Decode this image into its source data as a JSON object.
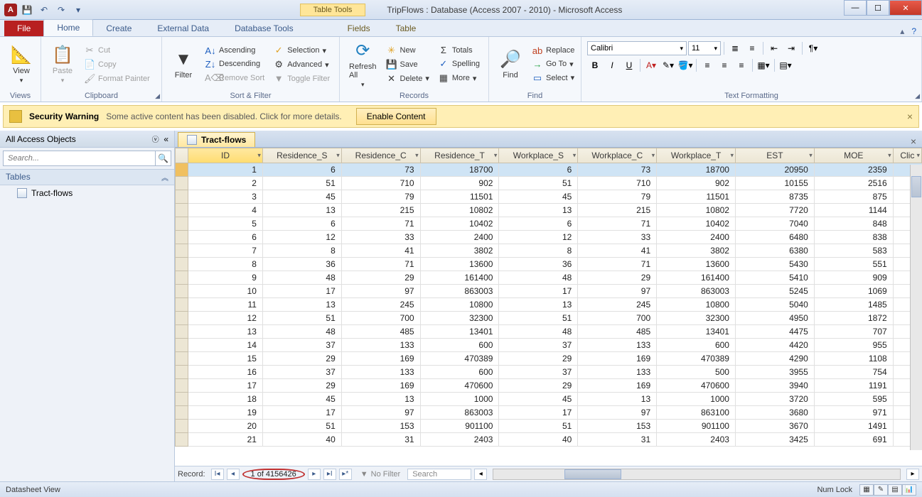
{
  "title": "TripFlows : Database (Access 2007 - 2010)  -  Microsoft Access",
  "tabletools": "Table Tools",
  "ribbontabs": {
    "file": "File",
    "home": "Home",
    "create": "Create",
    "external": "External Data",
    "dbtools": "Database Tools",
    "fields": "Fields",
    "table": "Table"
  },
  "groups": {
    "views": "Views",
    "clipboard": "Clipboard",
    "sortfilter": "Sort & Filter",
    "records": "Records",
    "find": "Find",
    "textfmt": "Text Formatting"
  },
  "btns": {
    "view": "View",
    "paste": "Paste",
    "cut": "Cut",
    "copy": "Copy",
    "fmtpainter": "Format Painter",
    "filter": "Filter",
    "asc": "Ascending",
    "desc": "Descending",
    "remsort": "Remove Sort",
    "selection": "Selection",
    "advanced": "Advanced",
    "togglefilter": "Toggle Filter",
    "refresh": "Refresh All",
    "new": "New",
    "save": "Save",
    "delete": "Delete",
    "totals": "Totals",
    "spelling": "Spelling",
    "more": "More",
    "find": "Find",
    "replace": "Replace",
    "goto": "Go To",
    "select": "Select"
  },
  "font": {
    "name": "Calibri",
    "size": "11"
  },
  "secwarn": {
    "title": "Security Warning",
    "text": "Some active content has been disabled. Click for more details.",
    "enable": "Enable Content"
  },
  "nav": {
    "header": "All Access Objects",
    "search_ph": "Search...",
    "group": "Tables",
    "item": "Tract-flows"
  },
  "tab": "Tract-flows",
  "columns": [
    "ID",
    "Residence_S",
    "Residence_C",
    "Residence_T",
    "Workplace_S",
    "Workplace_C",
    "Workplace_T",
    "EST",
    "MOE",
    "Clic"
  ],
  "rows": [
    [
      1,
      6,
      73,
      18700,
      6,
      73,
      18700,
      20950,
      2359
    ],
    [
      2,
      51,
      710,
      902,
      51,
      710,
      902,
      10155,
      2516
    ],
    [
      3,
      45,
      79,
      11501,
      45,
      79,
      11501,
      8735,
      875
    ],
    [
      4,
      13,
      215,
      10802,
      13,
      215,
      10802,
      7720,
      1144
    ],
    [
      5,
      6,
      71,
      10402,
      6,
      71,
      10402,
      7040,
      848
    ],
    [
      6,
      12,
      33,
      2400,
      12,
      33,
      2400,
      6480,
      838
    ],
    [
      7,
      8,
      41,
      3802,
      8,
      41,
      3802,
      6380,
      583
    ],
    [
      8,
      36,
      71,
      13600,
      36,
      71,
      13600,
      5430,
      551
    ],
    [
      9,
      48,
      29,
      161400,
      48,
      29,
      161400,
      5410,
      909
    ],
    [
      10,
      17,
      97,
      863003,
      17,
      97,
      863003,
      5245,
      1069
    ],
    [
      11,
      13,
      245,
      10800,
      13,
      245,
      10800,
      5040,
      1485
    ],
    [
      12,
      51,
      700,
      32300,
      51,
      700,
      32300,
      4950,
      1872
    ],
    [
      13,
      48,
      485,
      13401,
      48,
      485,
      13401,
      4475,
      707
    ],
    [
      14,
      37,
      133,
      600,
      37,
      133,
      600,
      4420,
      955
    ],
    [
      15,
      29,
      169,
      470389,
      29,
      169,
      470389,
      4290,
      1108
    ],
    [
      16,
      37,
      133,
      600,
      37,
      133,
      500,
      3955,
      754
    ],
    [
      17,
      29,
      169,
      470600,
      29,
      169,
      470600,
      3940,
      1191
    ],
    [
      18,
      45,
      13,
      1000,
      45,
      13,
      1000,
      3720,
      595
    ],
    [
      19,
      17,
      97,
      863003,
      17,
      97,
      863100,
      3680,
      971
    ],
    [
      20,
      51,
      153,
      901100,
      51,
      153,
      901100,
      3670,
      1491
    ],
    [
      21,
      40,
      31,
      2403,
      40,
      31,
      2403,
      3425,
      691
    ]
  ],
  "recnav": {
    "label": "Record:",
    "pos": "1 of 4156426",
    "nofilter": "No Filter",
    "search": "Search"
  },
  "status": {
    "view": "Datasheet View",
    "numlock": "Num Lock"
  }
}
